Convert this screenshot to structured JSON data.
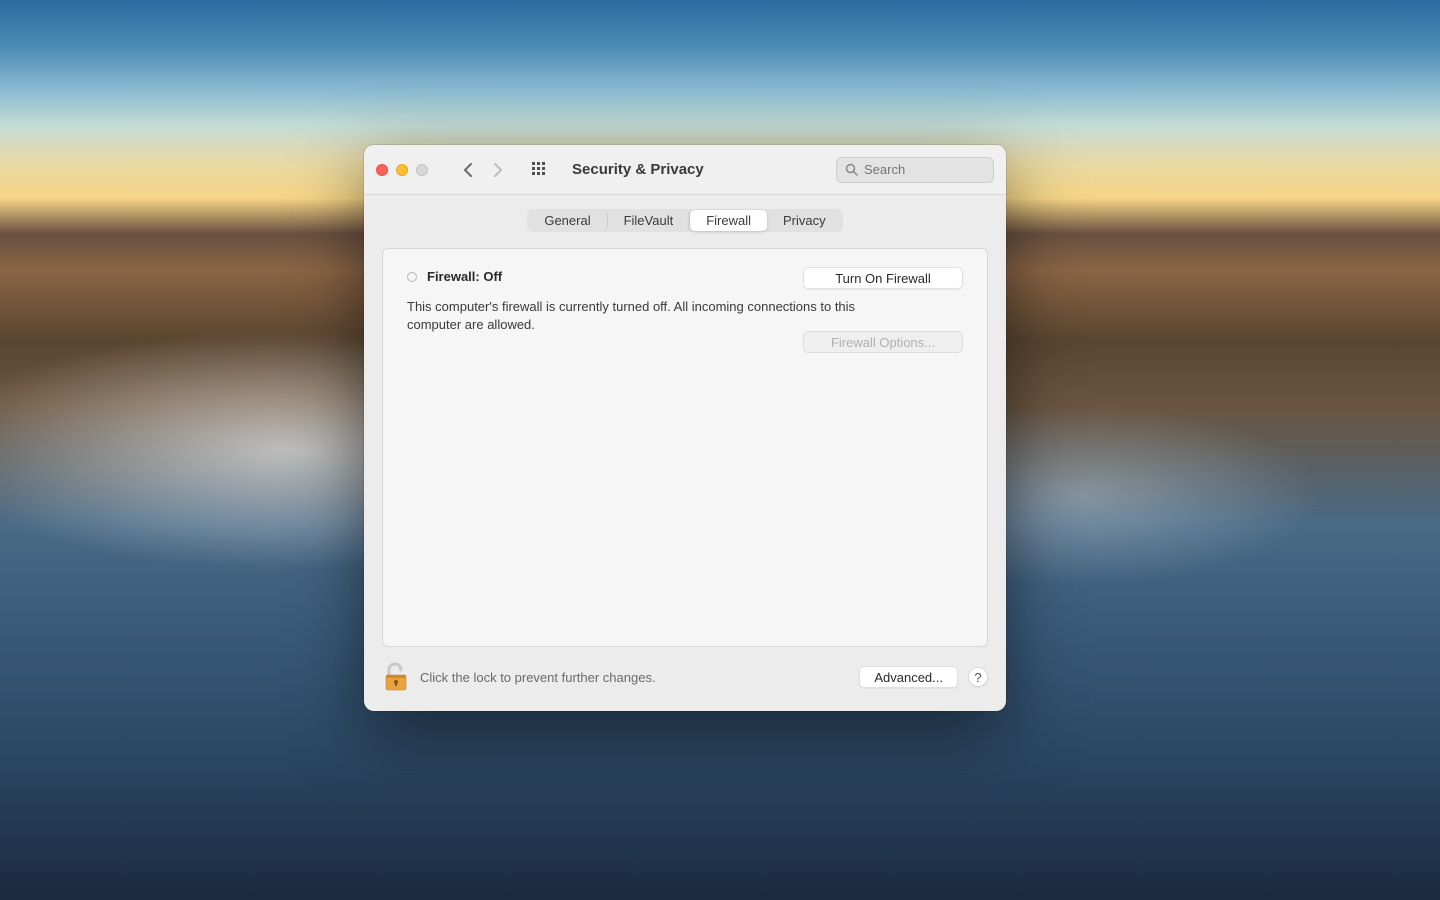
{
  "window": {
    "title": "Security & Privacy"
  },
  "search": {
    "placeholder": "Search"
  },
  "tabs": {
    "items": [
      {
        "label": "General"
      },
      {
        "label": "FileVault"
      },
      {
        "label": "Firewall"
      },
      {
        "label": "Privacy"
      }
    ],
    "active_index": 2
  },
  "firewall": {
    "status_label": "Firewall: Off",
    "turn_on_label": "Turn On Firewall",
    "description": "This computer's firewall is currently turned off. All incoming connections to this computer are allowed.",
    "options_label": "Firewall Options...",
    "options_enabled": false
  },
  "footer": {
    "lock_text": "Click the lock to prevent further changes.",
    "advanced_label": "Advanced...",
    "help_label": "?"
  }
}
